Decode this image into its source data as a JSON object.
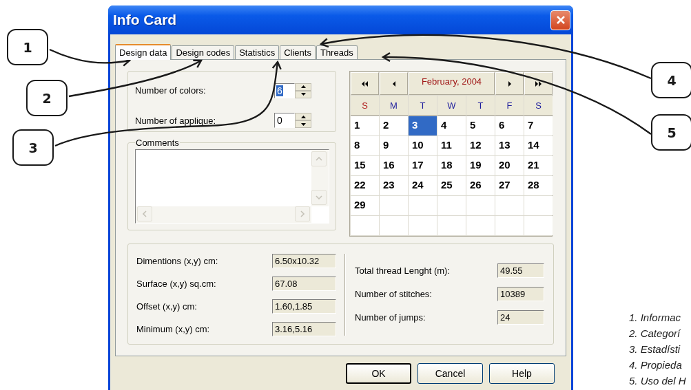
{
  "window": {
    "title": "Info Card"
  },
  "tabs": [
    {
      "label": "Design data",
      "selected": true
    },
    {
      "label": "Design codes",
      "selected": false
    },
    {
      "label": "Statistics",
      "selected": false
    },
    {
      "label": "Clients",
      "selected": false
    },
    {
      "label": "Threads",
      "selected": false
    }
  ],
  "design": {
    "fields": [
      {
        "label": "Number of colors:",
        "value": "6",
        "text_selected": true
      },
      {
        "label": "Number of applique:",
        "value": "0",
        "text_selected": false
      }
    ],
    "comments_label": "Comments"
  },
  "calendar": {
    "month": "February, 2004",
    "day_names": [
      {
        "label": "S",
        "color": "#b22222"
      },
      {
        "label": "M",
        "color": "#1c1c9c"
      },
      {
        "label": "T",
        "color": "#1c1c9c"
      },
      {
        "label": "W",
        "color": "#1c1c9c"
      },
      {
        "label": "T",
        "color": "#1c1c9c"
      },
      {
        "label": "F",
        "color": "#1c1c9c"
      },
      {
        "label": "S",
        "color": "#1c1c9c"
      }
    ],
    "weeks": [
      [
        {
          "day": "1",
          "selected": false
        },
        {
          "day": "2",
          "selected": false
        },
        {
          "day": "3",
          "selected": true
        },
        {
          "day": "4",
          "selected": false
        },
        {
          "day": "5",
          "selected": false
        },
        {
          "day": "6",
          "selected": false
        },
        {
          "day": "7",
          "selected": false
        }
      ],
      [
        {
          "day": "8",
          "selected": false
        },
        {
          "day": "9",
          "selected": false
        },
        {
          "day": "10",
          "selected": false
        },
        {
          "day": "11",
          "selected": false
        },
        {
          "day": "12",
          "selected": false
        },
        {
          "day": "13",
          "selected": false
        },
        {
          "day": "14",
          "selected": false
        }
      ],
      [
        {
          "day": "15",
          "selected": false
        },
        {
          "day": "16",
          "selected": false
        },
        {
          "day": "17",
          "selected": false
        },
        {
          "day": "18",
          "selected": false
        },
        {
          "day": "19",
          "selected": false
        },
        {
          "day": "20",
          "selected": false
        },
        {
          "day": "21",
          "selected": false
        }
      ],
      [
        {
          "day": "22",
          "selected": false
        },
        {
          "day": "23",
          "selected": false
        },
        {
          "day": "24",
          "selected": false
        },
        {
          "day": "25",
          "selected": false
        },
        {
          "day": "26",
          "selected": false
        },
        {
          "day": "27",
          "selected": false
        },
        {
          "day": "28",
          "selected": false
        }
      ],
      [
        {
          "day": "29",
          "selected": false
        }
      ]
    ]
  },
  "statistics": {
    "left": [
      {
        "label": "Dimentions (x,y) cm:",
        "value": "6.50x10.32"
      },
      {
        "label": "Surface (x,y) sq.cm:",
        "value": "67.08"
      },
      {
        "label": "Offset (x,y) cm:",
        "value": "1.60,1.85"
      },
      {
        "label": "Minimum (x,y) cm:",
        "value": "3.16,5.16"
      }
    ],
    "right": [
      {
        "label": "Total thread Lenght (m):",
        "value": "49.55"
      },
      {
        "label": "Number of stitches:",
        "value": "10389"
      },
      {
        "label": "Number of jumps:",
        "value": "24"
      }
    ]
  },
  "buttons": [
    {
      "label": "OK",
      "default": true
    },
    {
      "label": "Cancel",
      "default": false
    },
    {
      "label": "Help",
      "default": false
    }
  ],
  "callouts": [
    "1",
    "2",
    "3",
    "4",
    "5"
  ],
  "legend": [
    "1. Informac",
    "2. Categorí",
    "3. Estadísti",
    "4. Propieda",
    "5. Uso del H"
  ]
}
